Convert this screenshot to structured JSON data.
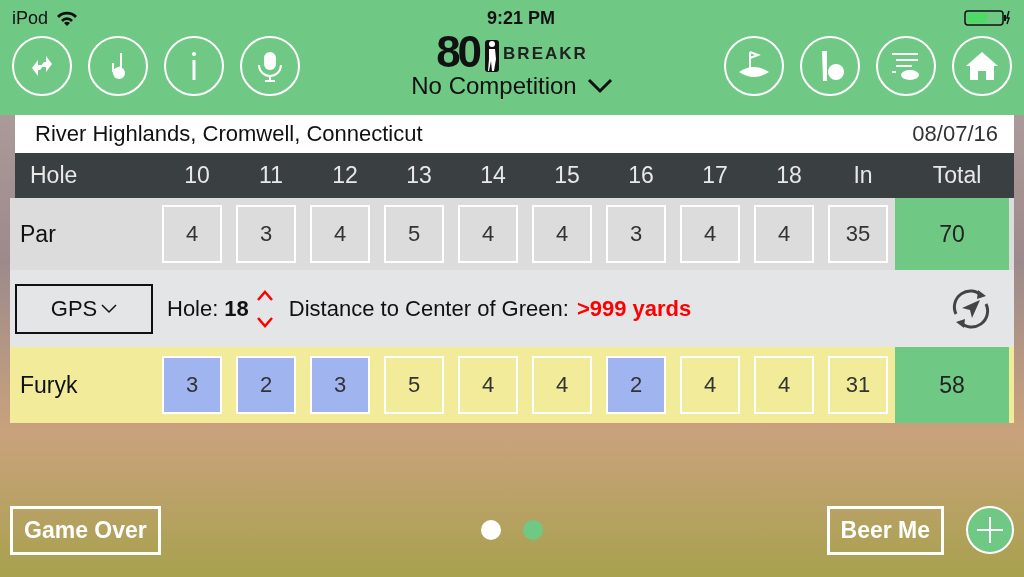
{
  "status_bar": {
    "carrier": "iPod",
    "time": "9:21 PM"
  },
  "logo": {
    "number": "80",
    "word": "BREAKR"
  },
  "competition": {
    "label": "No Competition"
  },
  "course": {
    "name": "River Highlands, Cromwell, Connecticut",
    "date": "08/07/16"
  },
  "scorecard": {
    "columns": [
      "Hole",
      "10",
      "11",
      "12",
      "13",
      "14",
      "15",
      "16",
      "17",
      "18",
      "In",
      "Total"
    ],
    "par": {
      "label": "Par",
      "scores": [
        {
          "value": "4"
        },
        {
          "value": "3"
        },
        {
          "value": "4"
        },
        {
          "value": "5"
        },
        {
          "value": "4"
        },
        {
          "value": "4"
        },
        {
          "value": "3"
        },
        {
          "value": "4"
        },
        {
          "value": "4"
        }
      ],
      "in": "35",
      "total": "70"
    },
    "gps": {
      "mode": "GPS",
      "hole_label": "Hole:",
      "hole": "18",
      "distance_label": "Distance to Center of Green:",
      "distance": ">999 yards"
    },
    "player": {
      "name": "Furyk",
      "scores": [
        {
          "value": "3",
          "under_par": true
        },
        {
          "value": "2",
          "under_par": true
        },
        {
          "value": "3",
          "under_par": true
        },
        {
          "value": "5",
          "under_par": false
        },
        {
          "value": "4",
          "under_par": false
        },
        {
          "value": "4",
          "under_par": false
        },
        {
          "value": "2",
          "under_par": true
        },
        {
          "value": "4",
          "under_par": false
        },
        {
          "value": "4",
          "under_par": false
        }
      ],
      "in": "31",
      "total": "58"
    }
  },
  "page_dots": [
    {
      "selected": false
    },
    {
      "selected": true
    }
  ],
  "buttons": [
    {
      "label": "Game Over"
    },
    {
      "label": "Beer Me"
    }
  ]
}
